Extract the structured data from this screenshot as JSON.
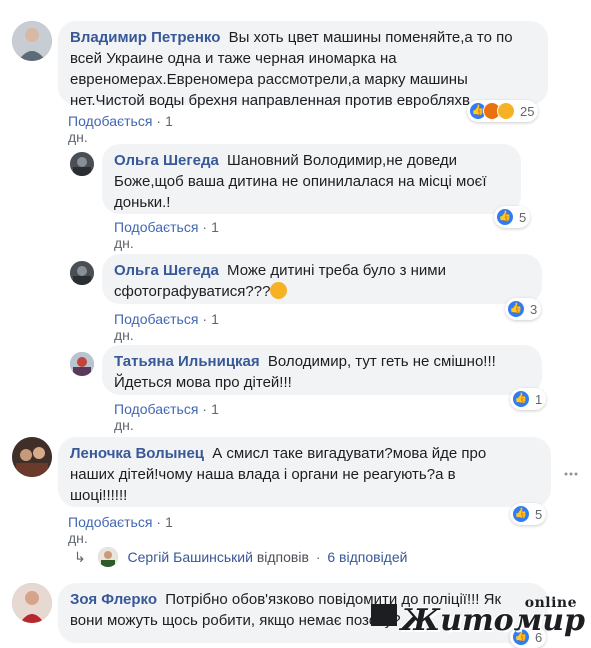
{
  "comments": [
    {
      "author": "Владимир Петренко",
      "text_lines": [
        "Вы хоть цвет машины поменяйте,а то по",
        "всей Украине одна и таже черная иномарка на",
        "евреномерах.Евреномера рассмотрели,а марку машины",
        "нет.Чистой воды брехня направленная против евробляхв."
      ],
      "like_label": "Подобається",
      "time": "1 дн.",
      "reactions_count": "25",
      "reactions": [
        "like-icon",
        "angry-icon",
        "wow-icon"
      ]
    },
    {
      "author": "Ольга Шегеда",
      "text_lines": [
        "Шановний Володимир,не доведи",
        "Боже,щоб ваша дитина не опинилалася на місці моєї",
        "доньки.!"
      ],
      "like_label": "Подобається",
      "time": "1 дн.",
      "reactions_count": "5",
      "reactions": [
        "like-icon"
      ]
    },
    {
      "author": "Ольга Шегеда",
      "text_lines": [
        "Може дитині треба було з ними",
        "сфотографуватися???"
      ],
      "like_label": "Подобається",
      "time": "1 дн.",
      "reactions_count": "3",
      "reactions": [
        "like-icon"
      ]
    },
    {
      "author": "Татьяна Ильницкая",
      "text_lines": [
        "Володимир, тут геть не смішно!!!",
        "Йдеться мова про дітей!!!"
      ],
      "like_label": "Подобається",
      "time": "1 дн.",
      "reactions_count": "1",
      "reactions": [
        "like-icon"
      ]
    },
    {
      "author": "Леночка Волынец",
      "text_lines": [
        "А смисл таке вигадувати?мова йде про",
        "наших дітей!чому наша влада і органи не реагують?а в",
        "шоці!!!!!!"
      ],
      "like_label": "Подобається",
      "time": "1 дн.",
      "reactions_count": "5",
      "reactions": [
        "like-icon"
      ]
    },
    {
      "author": "Зоя Флерко",
      "text_lines": [
        "Потрібно обов'язково повідомити до поліції!!! Як",
        "вони можуть щось робити, якщо немає позову?"
      ],
      "reactions_count": "6",
      "reactions": [
        "like-icon"
      ]
    }
  ],
  "replies_summary": {
    "name": "Сергій Башинський",
    "verb": "відповів",
    "count": "6 відповідей"
  },
  "watermark": {
    "online": "online",
    "main": "Житомир"
  },
  "colors": {
    "author": "#385898",
    "bubble": "#f2f3f5",
    "like": "#2e7cf6"
  }
}
